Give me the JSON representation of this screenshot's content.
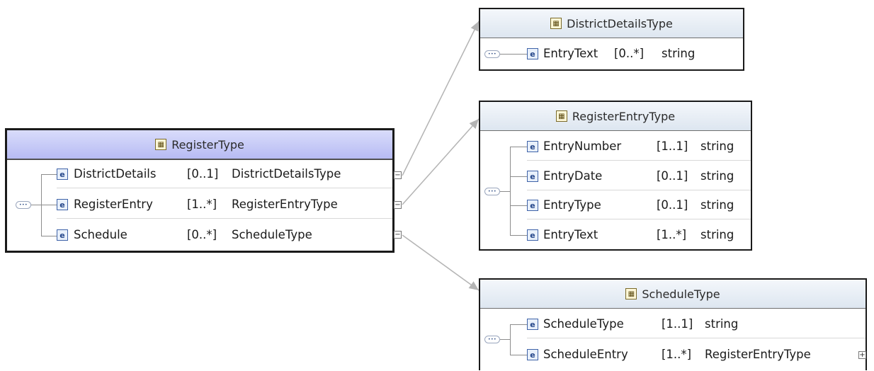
{
  "types": {
    "register": {
      "name": "RegisterType",
      "elements": [
        {
          "name": "DistrictDetails",
          "cardinality": "[0..1]",
          "type": "DistrictDetailsType",
          "toggle": "−"
        },
        {
          "name": "RegisterEntry",
          "cardinality": "[1..*]",
          "type": "RegisterEntryType",
          "toggle": "−"
        },
        {
          "name": "Schedule",
          "cardinality": "[0..*]",
          "type": "ScheduleType",
          "toggle": "−"
        }
      ]
    },
    "district_details": {
      "name": "DistrictDetailsType",
      "elements": [
        {
          "name": "EntryText",
          "cardinality": "[0..*]",
          "type": "string"
        }
      ]
    },
    "register_entry": {
      "name": "RegisterEntryType",
      "elements": [
        {
          "name": "EntryNumber",
          "cardinality": "[1..1]",
          "type": "string"
        },
        {
          "name": "EntryDate",
          "cardinality": "[0..1]",
          "type": "string"
        },
        {
          "name": "EntryType",
          "cardinality": "[0..1]",
          "type": "string"
        },
        {
          "name": "EntryText",
          "cardinality": "[1..*]",
          "type": "string"
        }
      ]
    },
    "schedule": {
      "name": "ScheduleType",
      "elements": [
        {
          "name": "ScheduleType",
          "cardinality": "[1..1]",
          "type": "string"
        },
        {
          "name": "ScheduleEntry",
          "cardinality": "[1..*]",
          "type": "RegisterEntryType",
          "toggle": "+"
        }
      ]
    }
  },
  "icons": {
    "type_icon": "complex-type-icon",
    "element_icon": "element-icon",
    "element_glyph": "e",
    "sequence_icon": "sequence-compositor-icon",
    "sequence_glyph": "•••"
  },
  "colors": {
    "root_header": "#b7bbf3",
    "type_header": "#dde6f0",
    "border": "#1a1a1a",
    "connector": "#b4b4b4",
    "element_icon": "#3f63a8"
  }
}
